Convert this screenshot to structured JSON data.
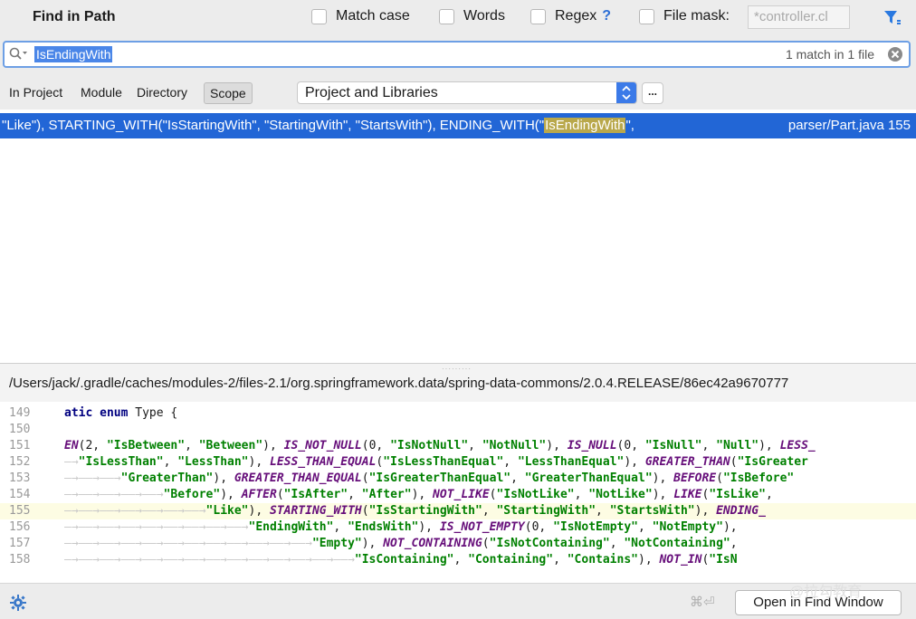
{
  "header": {
    "title": "Find in Path",
    "options": [
      {
        "label": "Match case"
      },
      {
        "label": "Words"
      },
      {
        "label": "Regex"
      },
      {
        "label": "File mask:"
      }
    ],
    "regex_help": "?",
    "file_mask_value": "*controller.cl"
  },
  "search": {
    "query": "IsEndingWith",
    "match_count": "1 match in 1 file"
  },
  "scope": {
    "tabs": [
      "In Project",
      "Module",
      "Directory",
      "Scope"
    ],
    "selected_tab": "Scope",
    "selected_scope": "Project and Libraries",
    "more_button": "..."
  },
  "results": {
    "text_before": "\"Like\"), STARTING_WITH(\"IsStartingWith\", \"StartingWith\", \"StartsWith\"), ENDING_WITH(\"",
    "highlight": "IsEndingWith",
    "text_after": "\",",
    "location": "parser/Part.java 155"
  },
  "file_path": "/Users/jack/.gradle/caches/modules-2/files-2.1/org.springframework.data/spring-data-commons/2.0.4.RELEASE/86ec42a9670777",
  "code": {
    "current_line": "155",
    "lines": [
      {
        "n": "149",
        "parts": [
          {
            "c": "kw",
            "t": "atic enum "
          },
          {
            "c": "",
            "t": "Type {"
          }
        ]
      },
      {
        "n": "150",
        "parts": []
      },
      {
        "n": "151",
        "parts": [
          {
            "c": "en",
            "t": "EN"
          },
          {
            "c": "",
            "t": "(2, "
          },
          {
            "c": "st",
            "t": "\"IsBetween\""
          },
          {
            "c": "",
            "t": ", "
          },
          {
            "c": "st",
            "t": "\"Between\""
          },
          {
            "c": "",
            "t": "), "
          },
          {
            "c": "en",
            "t": "IS_NOT_NULL"
          },
          {
            "c": "",
            "t": "(0, "
          },
          {
            "c": "st",
            "t": "\"IsNotNull\""
          },
          {
            "c": "",
            "t": ", "
          },
          {
            "c": "st",
            "t": "\"NotNull\""
          },
          {
            "c": "",
            "t": "), "
          },
          {
            "c": "en",
            "t": "IS_NULL"
          },
          {
            "c": "",
            "t": "(0, "
          },
          {
            "c": "st",
            "t": "\"IsNull\""
          },
          {
            "c": "",
            "t": ", "
          },
          {
            "c": "st",
            "t": "\"Null\""
          },
          {
            "c": "",
            "t": "), "
          },
          {
            "c": "en",
            "t": "LESS_"
          }
        ]
      },
      {
        "n": "152",
        "parts": [
          {
            "c": "ws",
            "t": "—→"
          },
          {
            "c": "st",
            "t": "\"IsLessThan\""
          },
          {
            "c": "",
            "t": ", "
          },
          {
            "c": "st",
            "t": "\"LessThan\""
          },
          {
            "c": "",
            "t": "), "
          },
          {
            "c": "en",
            "t": "LESS_THAN_EQUAL"
          },
          {
            "c": "",
            "t": "("
          },
          {
            "c": "st",
            "t": "\"IsLessThanEqual\""
          },
          {
            "c": "",
            "t": ", "
          },
          {
            "c": "st",
            "t": "\"LessThanEqual\""
          },
          {
            "c": "",
            "t": "), "
          },
          {
            "c": "en",
            "t": "GREATER_THAN"
          },
          {
            "c": "",
            "t": "("
          },
          {
            "c": "st",
            "t": "\"IsGreater"
          }
        ]
      },
      {
        "n": "153",
        "parts": [
          {
            "c": "ws",
            "t": "—→——→——→"
          },
          {
            "c": "st",
            "t": "\"GreaterThan\""
          },
          {
            "c": "",
            "t": "), "
          },
          {
            "c": "en",
            "t": "GREATER_THAN_EQUAL"
          },
          {
            "c": "",
            "t": "("
          },
          {
            "c": "st",
            "t": "\"IsGreaterThanEqual\""
          },
          {
            "c": "",
            "t": ", "
          },
          {
            "c": "st",
            "t": "\"GreaterThanEqual\""
          },
          {
            "c": "",
            "t": "), "
          },
          {
            "c": "en",
            "t": "BEFORE"
          },
          {
            "c": "",
            "t": "("
          },
          {
            "c": "st",
            "t": "\"IsBefore\""
          }
        ]
      },
      {
        "n": "154",
        "parts": [
          {
            "c": "ws",
            "t": "—→——→——→——→——→"
          },
          {
            "c": "st",
            "t": "\"Before\""
          },
          {
            "c": "",
            "t": "), "
          },
          {
            "c": "en",
            "t": "AFTER"
          },
          {
            "c": "",
            "t": "("
          },
          {
            "c": "st",
            "t": "\"IsAfter\""
          },
          {
            "c": "",
            "t": ", "
          },
          {
            "c": "st",
            "t": "\"After\""
          },
          {
            "c": "",
            "t": "), "
          },
          {
            "c": "en",
            "t": "NOT_LIKE"
          },
          {
            "c": "",
            "t": "("
          },
          {
            "c": "st",
            "t": "\"IsNotLike\""
          },
          {
            "c": "",
            "t": ", "
          },
          {
            "c": "st",
            "t": "\"NotLike\""
          },
          {
            "c": "",
            "t": "), "
          },
          {
            "c": "en",
            "t": "LIKE"
          },
          {
            "c": "",
            "t": "("
          },
          {
            "c": "st",
            "t": "\"IsLike\""
          },
          {
            "c": "",
            "t": ","
          }
        ]
      },
      {
        "n": "155",
        "parts": [
          {
            "c": "ws",
            "t": "—→——→——→——→——→——→——→"
          },
          {
            "c": "st",
            "t": "\"Like\""
          },
          {
            "c": "",
            "t": "), "
          },
          {
            "c": "en",
            "t": "STARTING_WITH"
          },
          {
            "c": "",
            "t": "("
          },
          {
            "c": "st",
            "t": "\"IsStartingWith\""
          },
          {
            "c": "",
            "t": ", "
          },
          {
            "c": "st",
            "t": "\"StartingWith\""
          },
          {
            "c": "",
            "t": ", "
          },
          {
            "c": "st",
            "t": "\"StartsWith\""
          },
          {
            "c": "",
            "t": "), "
          },
          {
            "c": "en",
            "t": "ENDING_"
          }
        ]
      },
      {
        "n": "156",
        "parts": [
          {
            "c": "ws",
            "t": "—→——→——→——→——→——→——→——→——→"
          },
          {
            "c": "st",
            "t": "\"EndingWith\""
          },
          {
            "c": "",
            "t": ", "
          },
          {
            "c": "st",
            "t": "\"EndsWith\""
          },
          {
            "c": "",
            "t": "), "
          },
          {
            "c": "en",
            "t": "IS_NOT_EMPTY"
          },
          {
            "c": "",
            "t": "(0, "
          },
          {
            "c": "st",
            "t": "\"IsNotEmpty\""
          },
          {
            "c": "",
            "t": ", "
          },
          {
            "c": "st",
            "t": "\"NotEmpty\""
          },
          {
            "c": "",
            "t": "), "
          }
        ]
      },
      {
        "n": "157",
        "parts": [
          {
            "c": "ws",
            "t": "—→——→——→——→——→——→——→——→——→——→——→——→"
          },
          {
            "c": "st",
            "t": "\"Empty\""
          },
          {
            "c": "",
            "t": "), "
          },
          {
            "c": "en",
            "t": "NOT_CONTAINING"
          },
          {
            "c": "",
            "t": "("
          },
          {
            "c": "st",
            "t": "\"IsNotContaining\""
          },
          {
            "c": "",
            "t": ", "
          },
          {
            "c": "st",
            "t": "\"NotContaining\""
          },
          {
            "c": "",
            "t": ", "
          }
        ]
      },
      {
        "n": "158",
        "parts": [
          {
            "c": "ws",
            "t": "—→——→——→——→——→——→——→——→——→——→——→——→——→——→"
          },
          {
            "c": "st",
            "t": "\"IsContaining\""
          },
          {
            "c": "",
            "t": ", "
          },
          {
            "c": "st",
            "t": "\"Containing\""
          },
          {
            "c": "",
            "t": ", "
          },
          {
            "c": "st",
            "t": "\"Contains\""
          },
          {
            "c": "",
            "t": "), "
          },
          {
            "c": "en",
            "t": "NOT_IN"
          },
          {
            "c": "",
            "t": "("
          },
          {
            "c": "st",
            "t": "\"IsN"
          }
        ]
      }
    ]
  },
  "footer": {
    "shortcut": "⌘⏎",
    "open_button": "Open in Find Window"
  },
  "watermark": "@拉勾教育",
  "colors": {
    "accent": "#2266d6",
    "search_border": "#6d9fe5",
    "match_highlight": "#b9a84b",
    "current_line": "#fdfce3"
  }
}
